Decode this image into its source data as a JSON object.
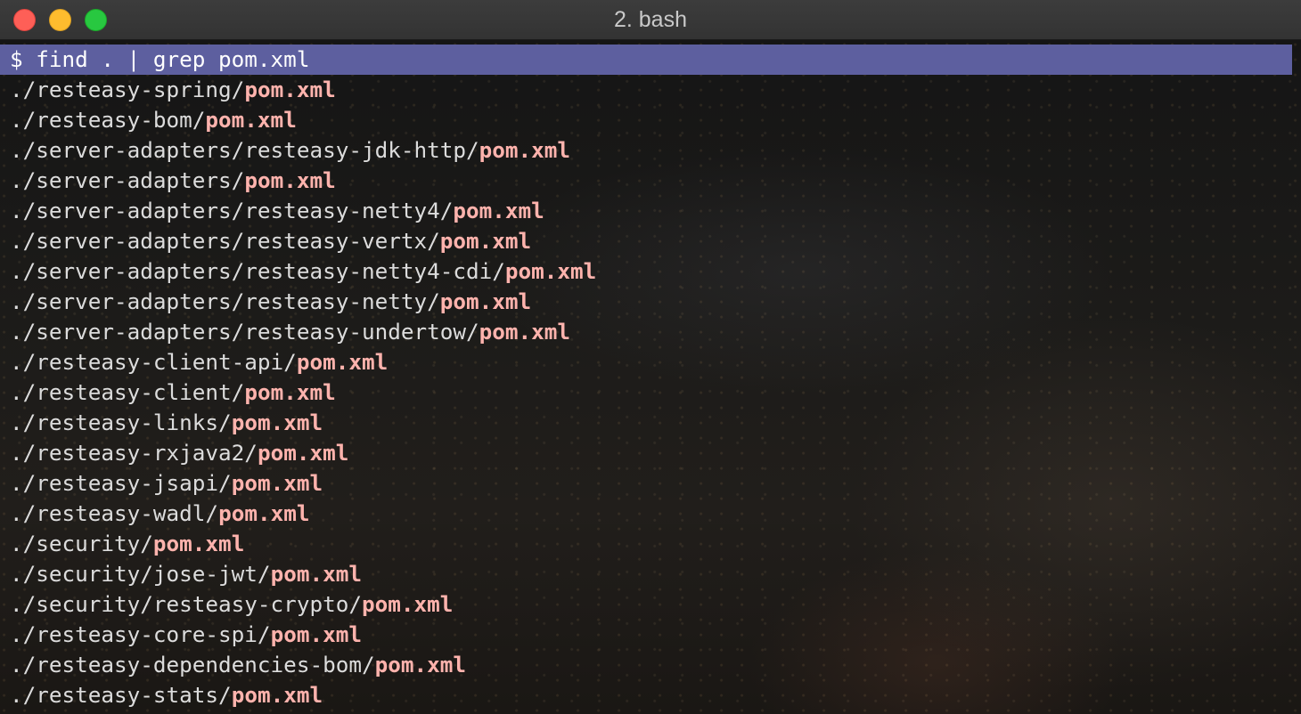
{
  "window": {
    "title": "2. bash"
  },
  "terminal": {
    "prompt": "$ find . | grep pom.xml",
    "results": [
      {
        "dir": "./resteasy-spring/",
        "file": "pom.xml"
      },
      {
        "dir": "./resteasy-bom/",
        "file": "pom.xml"
      },
      {
        "dir": "./server-adapters/resteasy-jdk-http/",
        "file": "pom.xml"
      },
      {
        "dir": "./server-adapters/",
        "file": "pom.xml"
      },
      {
        "dir": "./server-adapters/resteasy-netty4/",
        "file": "pom.xml"
      },
      {
        "dir": "./server-adapters/resteasy-vertx/",
        "file": "pom.xml"
      },
      {
        "dir": "./server-adapters/resteasy-netty4-cdi/",
        "file": "pom.xml"
      },
      {
        "dir": "./server-adapters/resteasy-netty/",
        "file": "pom.xml"
      },
      {
        "dir": "./server-adapters/resteasy-undertow/",
        "file": "pom.xml"
      },
      {
        "dir": "./resteasy-client-api/",
        "file": "pom.xml"
      },
      {
        "dir": "./resteasy-client/",
        "file": "pom.xml"
      },
      {
        "dir": "./resteasy-links/",
        "file": "pom.xml"
      },
      {
        "dir": "./resteasy-rxjava2/",
        "file": "pom.xml"
      },
      {
        "dir": "./resteasy-jsapi/",
        "file": "pom.xml"
      },
      {
        "dir": "./resteasy-wadl/",
        "file": "pom.xml"
      },
      {
        "dir": "./security/",
        "file": "pom.xml"
      },
      {
        "dir": "./security/jose-jwt/",
        "file": "pom.xml"
      },
      {
        "dir": "./security/resteasy-crypto/",
        "file": "pom.xml"
      },
      {
        "dir": "./resteasy-core-spi/",
        "file": "pom.xml"
      },
      {
        "dir": "./resteasy-dependencies-bom/",
        "file": "pom.xml"
      },
      {
        "dir": "./resteasy-stats/",
        "file": "pom.xml"
      }
    ]
  },
  "colors": {
    "highlight": "#5d5f9f",
    "file_match": "#ffb3ad",
    "close": "#fe5f57",
    "minimize": "#febc2e",
    "zoom": "#28c840"
  }
}
